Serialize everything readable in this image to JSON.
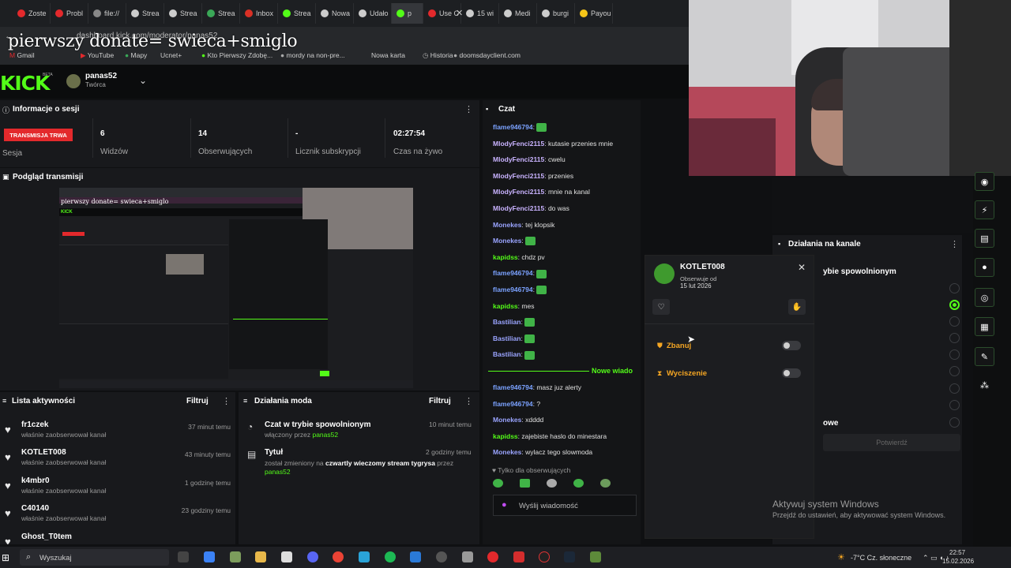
{
  "overlay": {
    "donate_text": "pierwszy donate= swieca+smiglo"
  },
  "browser": {
    "tabs": [
      {
        "label": "Zoste",
        "color": "#e3292c"
      },
      {
        "label": "Probl",
        "color": "#e3292c"
      },
      {
        "label": "file://",
        "color": "#888888"
      },
      {
        "label": "Strea",
        "color": "#cccccc"
      },
      {
        "label": "Strea",
        "color": "#cccccc"
      },
      {
        "label": "Strea",
        "color": "#3aa757"
      },
      {
        "label": "Inbox",
        "color": "#d93025"
      },
      {
        "label": "Strea",
        "color": "#53fc18"
      },
      {
        "label": "Nowa",
        "color": "#cccccc"
      },
      {
        "label": "Udało",
        "color": "#cccccc"
      },
      {
        "label": "p",
        "color": "#53fc18"
      },
      {
        "label": "Use C",
        "color": "#e3292c"
      },
      {
        "label": "15 wi",
        "color": "#cccccc"
      },
      {
        "label": "Medi",
        "color": "#cccccc"
      },
      {
        "label": "burgi",
        "color": "#cccccc"
      },
      {
        "label": "Payou",
        "color": "#f5c518"
      }
    ],
    "url": "dashboard.kick.com/moderator/panas52",
    "bookmarks": [
      "Gmail",
      "YouTube",
      "Mapy",
      "Ucnet+",
      "Kto Pierwszy Zdobę...",
      "mordy na non-pre...",
      "Nowa karta",
      "Historia",
      "doomsdayclient.com"
    ]
  },
  "header": {
    "logo": "KICK",
    "beta": "BETA",
    "username": "panas52",
    "role": "Twórca"
  },
  "session": {
    "title": "Informacje o sesji",
    "live_badge": "TRANSMISJA TRWA",
    "sesja_label": "Sesja",
    "stats": [
      {
        "value": "6",
        "label": "Widzów"
      },
      {
        "value": "14",
        "label": "Obserwujących"
      },
      {
        "value": "-",
        "label": "Licznik subskrypcji"
      },
      {
        "value": "02:27:54",
        "label": "Czas na żywo"
      }
    ]
  },
  "preview": {
    "title": "Podgląd transmisji",
    "inner_donate": "pierwszy donate= swieca+smiglo"
  },
  "activity": {
    "title": "Lista aktywności",
    "filter": "Filtruj",
    "items": [
      {
        "name": "fr1czek",
        "desc": "właśnie zaobserwował kanał",
        "time": "37 minut temu"
      },
      {
        "name": "KOTLET008",
        "desc": "właśnie zaobserwował kanał",
        "time": "43 minuty temu"
      },
      {
        "name": "k4mbr0",
        "desc": "właśnie zaobserwował kanał",
        "time": "1 godzinę temu"
      },
      {
        "name": "C40140",
        "desc": "właśnie zaobserwował kanał",
        "time": "23 godziny temu"
      },
      {
        "name": "Ghost_T0tem",
        "desc": "",
        "time": ""
      }
    ]
  },
  "mod_actions": {
    "title": "Działania moda",
    "filter": "Filtruj",
    "items": [
      {
        "title": "Czat w trybie spowolnionym",
        "desc_prefix": "włączony przez ",
        "desc_user": "panas52",
        "time": "10 minut temu"
      },
      {
        "title": "Tytuł",
        "desc_prefix": "został zmieniony na ",
        "desc_bold": "czwartly wieczomy stream tygrysa",
        "desc_mid": " przez ",
        "desc_user": "panas52",
        "time": "2 godziny temu"
      }
    ]
  },
  "chat": {
    "title": "Czat",
    "messages": [
      {
        "user": "flame946794",
        "color": "#7ba2ff",
        "text": "",
        "emote": true
      },
      {
        "user": "MlodyFenci2115",
        "color": "#c9b3ff",
        "text": "kutasie przenies mnie"
      },
      {
        "user": "MlodyFenci2115",
        "color": "#c9b3ff",
        "text": "cwelu"
      },
      {
        "user": "MlodyFenci2115",
        "color": "#c9b3ff",
        "text": "przenies"
      },
      {
        "user": "MlodyFenci2115",
        "color": "#c9b3ff",
        "text": "mnie na kanal"
      },
      {
        "user": "MlodyFenci2115",
        "color": "#c9b3ff",
        "text": "do was"
      },
      {
        "user": "Monekes",
        "color": "#9aa4ff",
        "text": "tej klopsik"
      },
      {
        "user": "Monekes",
        "color": "#9aa4ff",
        "text": "",
        "emote": true
      },
      {
        "user": "kapidss",
        "color": "#53fc18",
        "text": "chdz pv"
      },
      {
        "user": "flame946794",
        "color": "#7ba2ff",
        "text": "",
        "emote": true
      },
      {
        "user": "flame946794",
        "color": "#7ba2ff",
        "text": "",
        "emote": true
      },
      {
        "user": "kapidss",
        "color": "#53fc18",
        "text": "mes"
      },
      {
        "user": "Bastilian",
        "color": "#9aa4ff",
        "text": "",
        "emote": true
      },
      {
        "user": "Bastilian",
        "color": "#9aa4ff",
        "text": "",
        "emote": true
      },
      {
        "user": "Bastilian",
        "color": "#9aa4ff",
        "text": "",
        "emote": true
      }
    ],
    "new_messages": "Nowe wiado",
    "messages_after": [
      {
        "user": "flame946794",
        "color": "#7ba2ff",
        "text": "masz juz alerty"
      },
      {
        "user": "flame946794",
        "color": "#7ba2ff",
        "text": "?"
      },
      {
        "user": "Monekes",
        "color": "#9aa4ff",
        "text": "xdddd"
      },
      {
        "user": "kapidss",
        "color": "#53fc18",
        "text": "zajebiste haslo do minestara"
      },
      {
        "user": "Monekes",
        "color": "#9aa4ff",
        "text": "wylacz tego slowmoda"
      }
    ],
    "followers_only": "Tylko dla obserwujących",
    "input_placeholder": "Wyślij wiadomość"
  },
  "user_card": {
    "username": "KOTLET008",
    "following_label": "Obserwuje od",
    "following_date": "15 lut 2026",
    "ban_label": "Zbanuj",
    "mute_label": "Wyciszenie"
  },
  "channel_actions": {
    "title": "Działania na kanale",
    "slow_label": "ybie spowolnionym",
    "followers_label": "owe",
    "confirm": "Potwierdź"
  },
  "windows": {
    "activate_title": "Aktywuj system Windows",
    "activate_desc": "Przejdź do ustawień, aby aktywować system Windows.",
    "search": "Wyszukaj",
    "weather": "-7°C  Cz. słoneczne",
    "time": "22:57",
    "date": "15.02.2026"
  }
}
